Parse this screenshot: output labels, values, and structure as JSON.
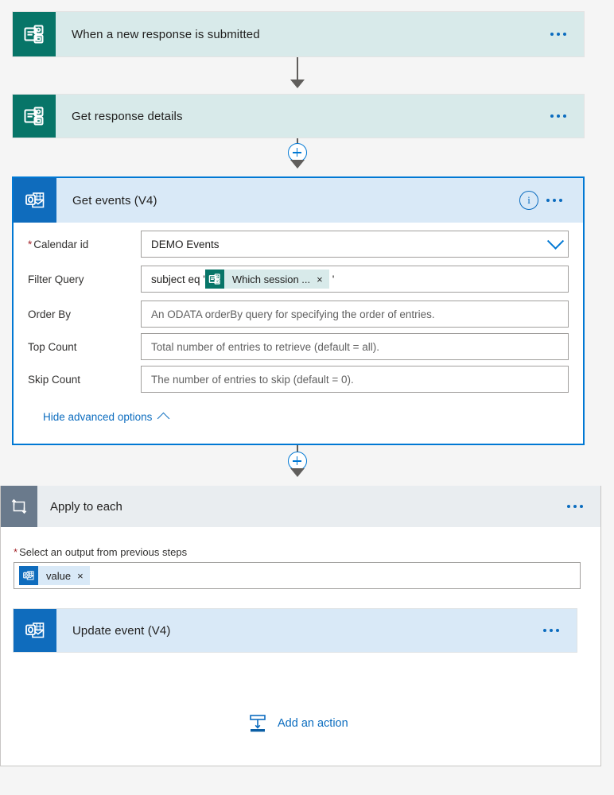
{
  "colors": {
    "page_background": "#f5f5f5",
    "teal_card": "#d8eaea",
    "teal_icon": "#077568",
    "blue_card": "#d9e9f7",
    "blue_icon": "#0f6cbd",
    "gray_icon": "#6a7a8c",
    "selected_border": "#0078d4",
    "link": "#0b6cbf",
    "required_asterisk": "#a4262c",
    "connector": "#605e5c",
    "scope_header": "#e9edf0"
  },
  "flow": {
    "trigger": {
      "title": "When a new response is submitted",
      "icon": "microsoft-forms-icon",
      "more_label": "..."
    },
    "get_response": {
      "title": "Get response details",
      "icon": "microsoft-forms-icon",
      "more_label": "..."
    },
    "get_events": {
      "title": "Get events (V4)",
      "icon": "outlook-icon",
      "info_label": "i",
      "more_label": "...",
      "params": [
        {
          "label": "Calendar id",
          "required": true,
          "type": "dropdown",
          "value": "DEMO Events",
          "placeholder": ""
        },
        {
          "label": "Filter Query",
          "required": false,
          "type": "token-text",
          "prefix": "subject eq '",
          "token": {
            "text": "Which session ...",
            "icon": "microsoft-forms-icon",
            "remove_label": "×"
          },
          "suffix": "'",
          "placeholder": ""
        },
        {
          "label": "Order By",
          "required": false,
          "type": "text",
          "value": "",
          "placeholder": "An ODATA orderBy query for specifying the order of entries."
        },
        {
          "label": "Top Count",
          "required": false,
          "type": "text",
          "value": "",
          "placeholder": "Total number of entries to retrieve (default = all)."
        },
        {
          "label": "Skip Count",
          "required": false,
          "type": "text",
          "value": "",
          "placeholder": "The number of entries to skip (default = 0)."
        }
      ],
      "advanced_options_label": "Hide advanced options"
    },
    "apply_to_each": {
      "title": "Apply to each",
      "icon": "loop-icon",
      "more_label": "...",
      "output_label": "Select an output from previous steps",
      "output_required": true,
      "output_token": {
        "text": "value",
        "icon": "outlook-icon",
        "remove_label": "×"
      },
      "child_action": {
        "title": "Update event (V4)",
        "icon": "outlook-icon",
        "more_label": "..."
      },
      "add_action_label": "Add an action",
      "add_action_icon": "insert-action-icon"
    },
    "connectors": {
      "plus_label": "+"
    }
  }
}
